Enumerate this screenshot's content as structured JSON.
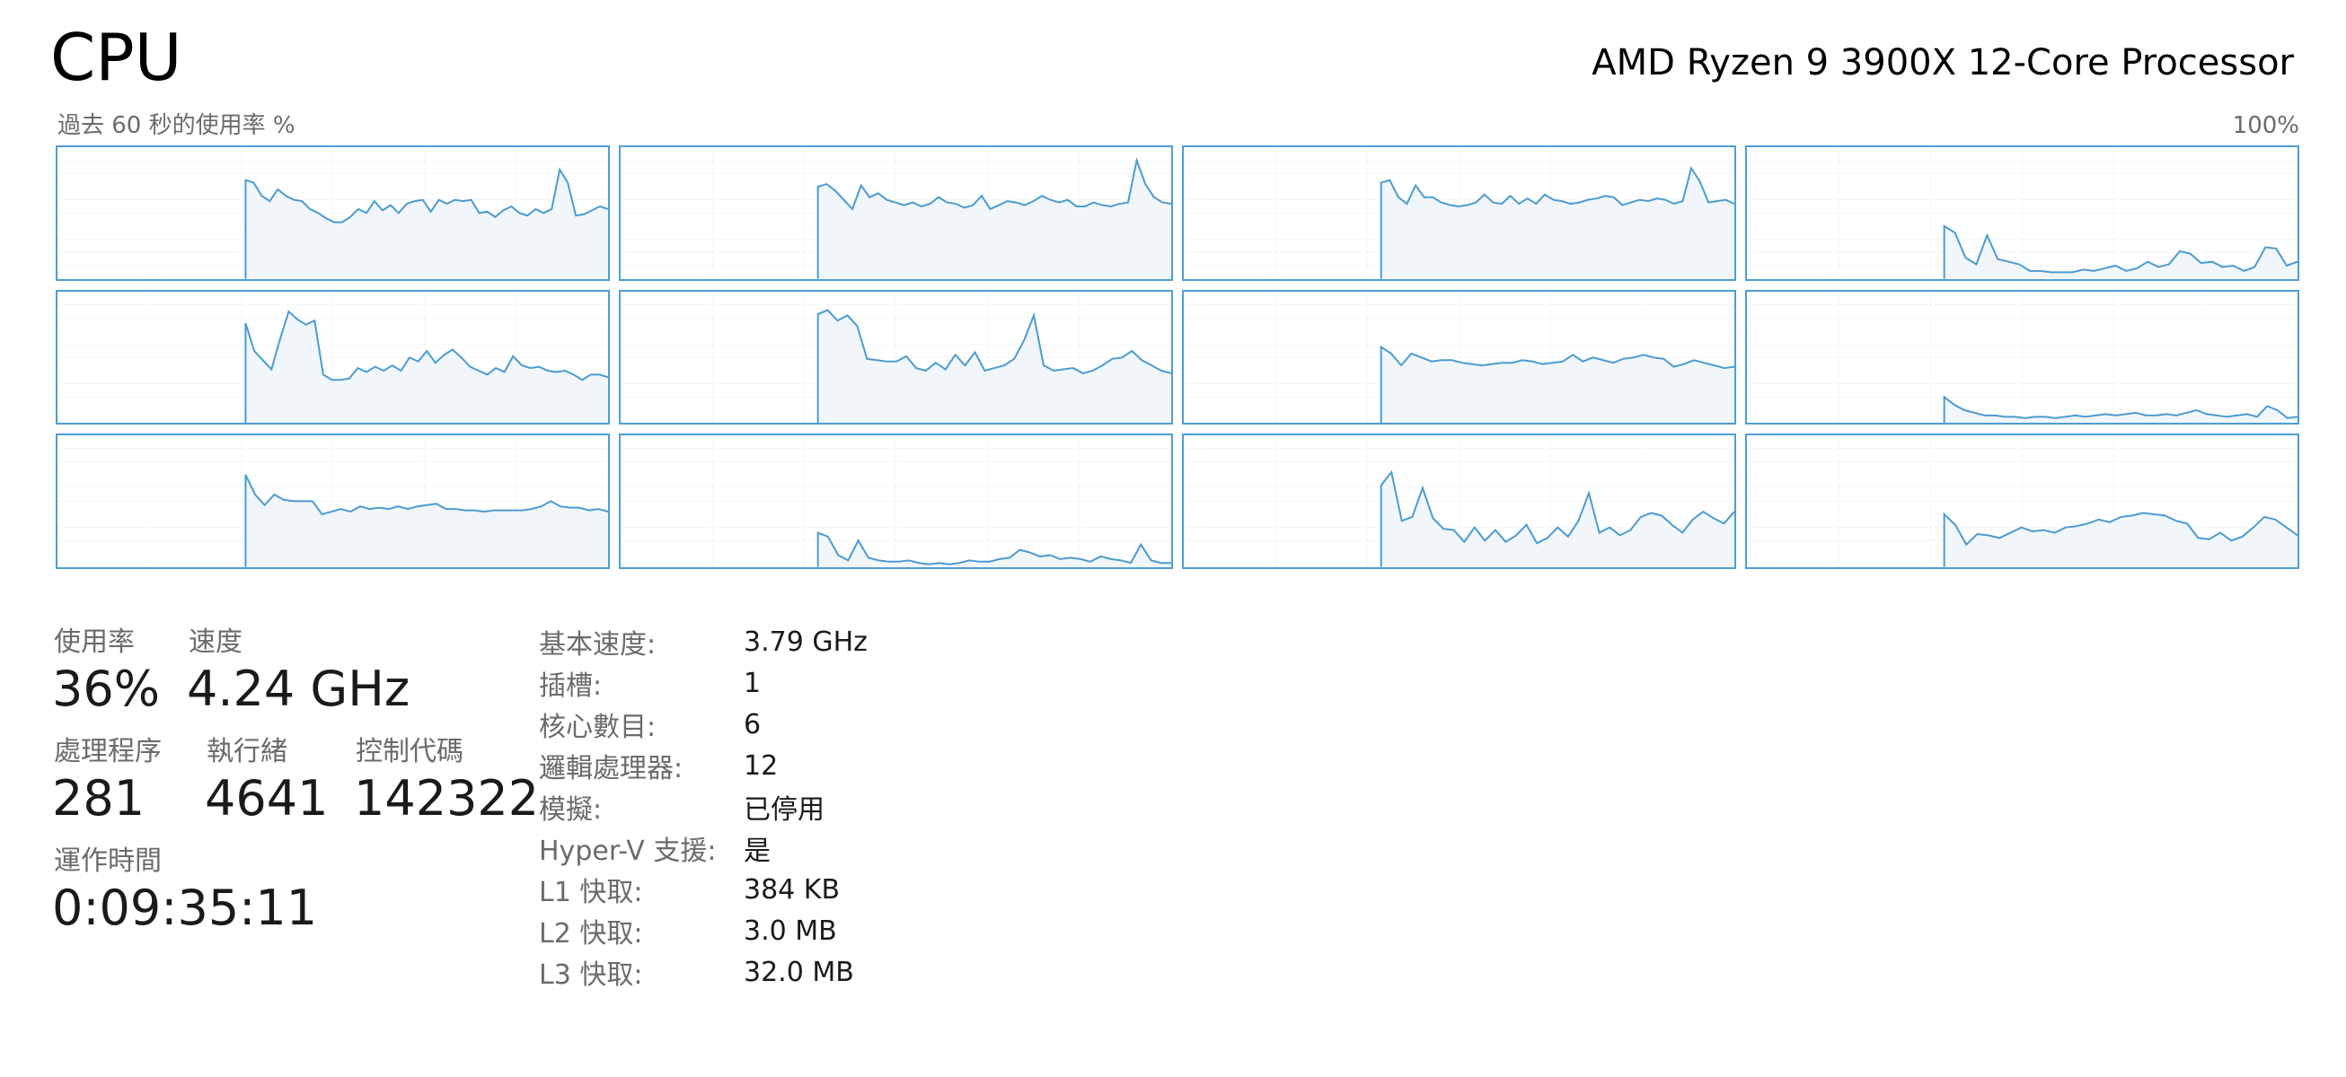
{
  "header": {
    "title": "CPU",
    "processor_name": "AMD Ryzen 9 3900X 12-Core Processor"
  },
  "graph": {
    "caption": "過去 60 秒的使用率 %",
    "max_label": "100%"
  },
  "stats": {
    "utilization_label": "使用率",
    "utilization_value": "36%",
    "speed_label": "速度",
    "speed_value": "4.24 GHz",
    "processes_label": "處理程序",
    "processes_value": "281",
    "threads_label": "執行緒",
    "threads_value": "4641",
    "handles_label": "控制代碼",
    "handles_value": "142322",
    "uptime_label": "運作時間",
    "uptime_value": "0:09:35:11"
  },
  "specs": [
    {
      "key": "基本速度:",
      "value": "3.79 GHz"
    },
    {
      "key": "插槽:",
      "value": "1"
    },
    {
      "key": "核心數目:",
      "value": "6"
    },
    {
      "key": "邏輯處理器:",
      "value": "12"
    },
    {
      "key": "模擬:",
      "value": "已停用"
    },
    {
      "key": "Hyper-V 支援:",
      "value": "是"
    },
    {
      "key": "L1 快取:",
      "value": "384 KB"
    },
    {
      "key": "L2 快取:",
      "value": "3.0 MB"
    },
    {
      "key": "L3 快取:",
      "value": "32.0 MB"
    }
  ],
  "chart_data": {
    "type": "area",
    "title": "過去 60 秒的使用率 %",
    "x_unit": "seconds",
    "x_range": [
      0,
      60
    ],
    "ylim": [
      0,
      100
    ],
    "grid": true,
    "colors": {
      "line": "#4b9bd2",
      "fill": "#f1f6fb",
      "border": "#4d9ed6",
      "grid": "#dfeaf4"
    },
    "series": [
      {
        "start": 20.5,
        "values": [
          75,
          73,
          63,
          59,
          68,
          63,
          60,
          59,
          53,
          50,
          46,
          43,
          43,
          47,
          53,
          50,
          59,
          52,
          56,
          50,
          57,
          59,
          60,
          51,
          60,
          57,
          60,
          59,
          60,
          50,
          51,
          47,
          52,
          55,
          50,
          48,
          53,
          50,
          53,
          83,
          73,
          48,
          49,
          52,
          55,
          53
        ]
      },
      {
        "start": 21.5,
        "values": [
          70,
          72,
          67,
          60,
          53,
          71,
          62,
          65,
          60,
          58,
          56,
          58,
          55,
          57,
          62,
          58,
          57,
          54,
          56,
          63,
          53,
          56,
          59,
          58,
          56,
          59,
          63,
          60,
          58,
          60,
          55,
          55,
          58,
          56,
          55,
          57,
          58,
          90,
          72,
          62,
          58,
          57
        ]
      },
      {
        "start": 21.5,
        "values": [
          73,
          75,
          62,
          57,
          71,
          62,
          62,
          58,
          56,
          55,
          56,
          58,
          64,
          58,
          57,
          63,
          57,
          61,
          57,
          64,
          60,
          59,
          57,
          58,
          60,
          61,
          63,
          62,
          56,
          58,
          60,
          59,
          61,
          60,
          57,
          59,
          84,
          74,
          58,
          59,
          60,
          57
        ]
      },
      {
        "start": 21.5,
        "values": [
          40,
          35,
          16,
          11,
          33,
          15,
          13,
          11,
          6,
          6,
          5,
          5,
          5,
          7,
          6,
          8,
          10,
          6,
          8,
          13,
          9,
          11,
          21,
          19,
          12,
          13,
          9,
          10,
          6,
          9,
          24,
          23,
          10,
          13
        ]
      },
      {
        "start": 20.5,
        "values": [
          76,
          55,
          48,
          41,
          64,
          85,
          79,
          75,
          78,
          37,
          33,
          33,
          34,
          42,
          39,
          43,
          40,
          44,
          40,
          50,
          47,
          55,
          46,
          52,
          56,
          50,
          43,
          40,
          37,
          42,
          39,
          51,
          44,
          42,
          43,
          40,
          39,
          40,
          37,
          33,
          37,
          37,
          35
        ]
      },
      {
        "start": 21.5,
        "values": [
          83,
          86,
          78,
          82,
          74,
          49,
          48,
          47,
          47,
          51,
          42,
          40,
          46,
          41,
          52,
          44,
          54,
          40,
          42,
          44,
          49,
          63,
          82,
          44,
          40,
          41,
          42,
          38,
          40,
          44,
          49,
          50,
          55,
          48,
          44,
          40,
          38
        ]
      },
      {
        "start": 21.5,
        "values": [
          58,
          53,
          44,
          53,
          50,
          47,
          48,
          48,
          46,
          45,
          44,
          45,
          46,
          46,
          48,
          47,
          45,
          46,
          47,
          52,
          47,
          50,
          48,
          46,
          49,
          50,
          52,
          50,
          49,
          43,
          45,
          48,
          46,
          44,
          42,
          43
        ]
      },
      {
        "start": 21.5,
        "values": [
          20,
          14,
          10,
          8,
          6,
          6,
          5,
          5,
          4,
          5,
          5,
          4,
          5,
          6,
          5,
          6,
          7,
          6,
          7,
          8,
          6,
          6,
          7,
          6,
          8,
          10,
          7,
          6,
          5,
          6,
          7,
          5,
          13,
          10,
          4,
          5
        ]
      },
      {
        "start": 20.5,
        "values": [
          70,
          55,
          47,
          55,
          51,
          50,
          50,
          50,
          40,
          42,
          44,
          42,
          46,
          44,
          45,
          44,
          46,
          44,
          46,
          47,
          48,
          44,
          44,
          43,
          43,
          42,
          43,
          43,
          43,
          43,
          44,
          46,
          50,
          46,
          45,
          45,
          43,
          44,
          42
        ]
      },
      {
        "start": 21.5,
        "values": [
          26,
          23,
          9,
          5,
          20,
          7,
          5,
          4,
          4,
          5,
          3,
          2,
          3,
          2,
          3,
          5,
          4,
          4,
          6,
          7,
          13,
          11,
          8,
          9,
          6,
          7,
          6,
          4,
          8,
          6,
          5,
          3,
          17,
          5,
          3,
          3
        ]
      },
      {
        "start": 21.5,
        "values": [
          62,
          72,
          35,
          38,
          60,
          37,
          29,
          28,
          19,
          30,
          20,
          28,
          19,
          24,
          32,
          18,
          22,
          30,
          23,
          35,
          56,
          26,
          30,
          24,
          28,
          38,
          41,
          39,
          32,
          26,
          36,
          42,
          37,
          33,
          42
        ]
      },
      {
        "start": 21.5,
        "values": [
          40,
          32,
          17,
          25,
          24,
          22,
          26,
          30,
          27,
          28,
          26,
          30,
          31,
          33,
          36,
          34,
          38,
          39,
          41,
          40,
          39,
          35,
          33,
          22,
          21,
          26,
          20,
          23,
          30,
          38,
          36,
          30,
          24
        ]
      }
    ]
  }
}
